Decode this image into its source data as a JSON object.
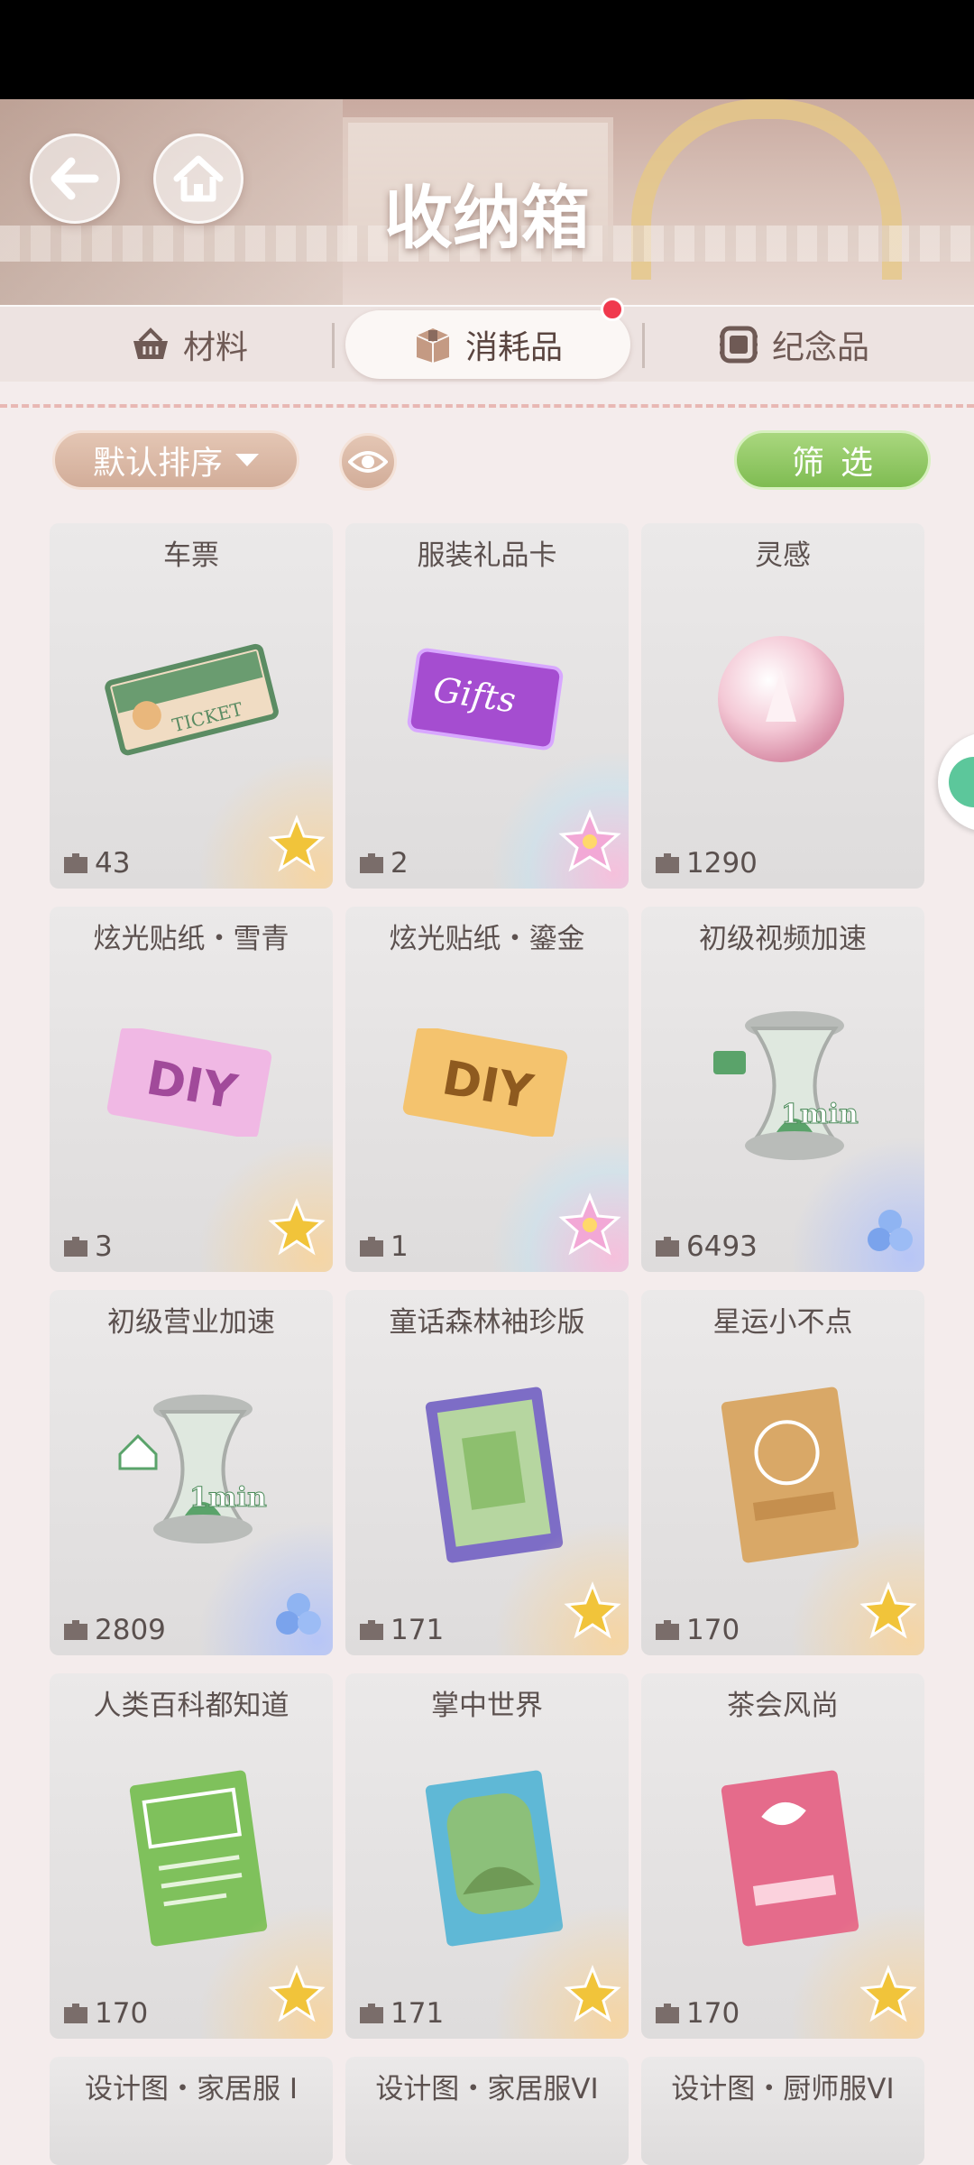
{
  "header": {
    "title": "收纳箱"
  },
  "tabs": [
    {
      "label": "材料",
      "icon": "basket-icon",
      "selected": false
    },
    {
      "label": "消耗品",
      "icon": "box-icon",
      "selected": true
    },
    {
      "label": "纪念品",
      "icon": "badge-icon",
      "selected": false
    }
  ],
  "toolbar": {
    "sort_label": "默认排序",
    "filter_label": "筛选"
  },
  "colors": {
    "accent_green": "#7fbc52",
    "sort_brown": "#d2ad99",
    "notify_red": "#f0394d"
  },
  "items": [
    {
      "name": "车票",
      "count": "43",
      "rarity": "gold",
      "art": "ticket"
    },
    {
      "name": "服装礼品卡",
      "count": "2",
      "rarity": "rainbow",
      "art": "giftcard"
    },
    {
      "name": "灵感",
      "count": "1290",
      "rarity": "none",
      "art": "orb"
    },
    {
      "name": "炫光贴纸・雪青",
      "count": "3",
      "rarity": "gold",
      "art": "diy-pink"
    },
    {
      "name": "炫光贴纸・鎏金",
      "count": "1",
      "rarity": "rainbow",
      "art": "diy-gold"
    },
    {
      "name": "初级视频加速",
      "count": "6493",
      "rarity": "blue",
      "art": "hourglass-video"
    },
    {
      "name": "初级营业加速",
      "count": "2809",
      "rarity": "blue",
      "art": "hourglass-shop"
    },
    {
      "name": "童话森林袖珍版",
      "count": "171",
      "rarity": "gold",
      "art": "book-purple"
    },
    {
      "name": "星运小不点",
      "count": "170",
      "rarity": "gold",
      "art": "book-tan"
    },
    {
      "name": "人类百科都知道",
      "count": "170",
      "rarity": "gold",
      "art": "book-green"
    },
    {
      "name": "掌中世界",
      "count": "171",
      "rarity": "gold",
      "art": "book-blue"
    },
    {
      "name": "茶会风尚",
      "count": "170",
      "rarity": "gold",
      "art": "book-pink"
    },
    {
      "name": "设计图・家居服 I",
      "count": "",
      "rarity": "none",
      "art": ""
    },
    {
      "name": "设计图・家居服VI",
      "count": "",
      "rarity": "none",
      "art": ""
    },
    {
      "name": "设计图・厨师服VI",
      "count": "",
      "rarity": "none",
      "art": ""
    }
  ],
  "labels": {
    "hourglass_time": "1min",
    "ticket_text": "TICKET",
    "gift_text": "Gifts",
    "diy_text": "DIY"
  }
}
